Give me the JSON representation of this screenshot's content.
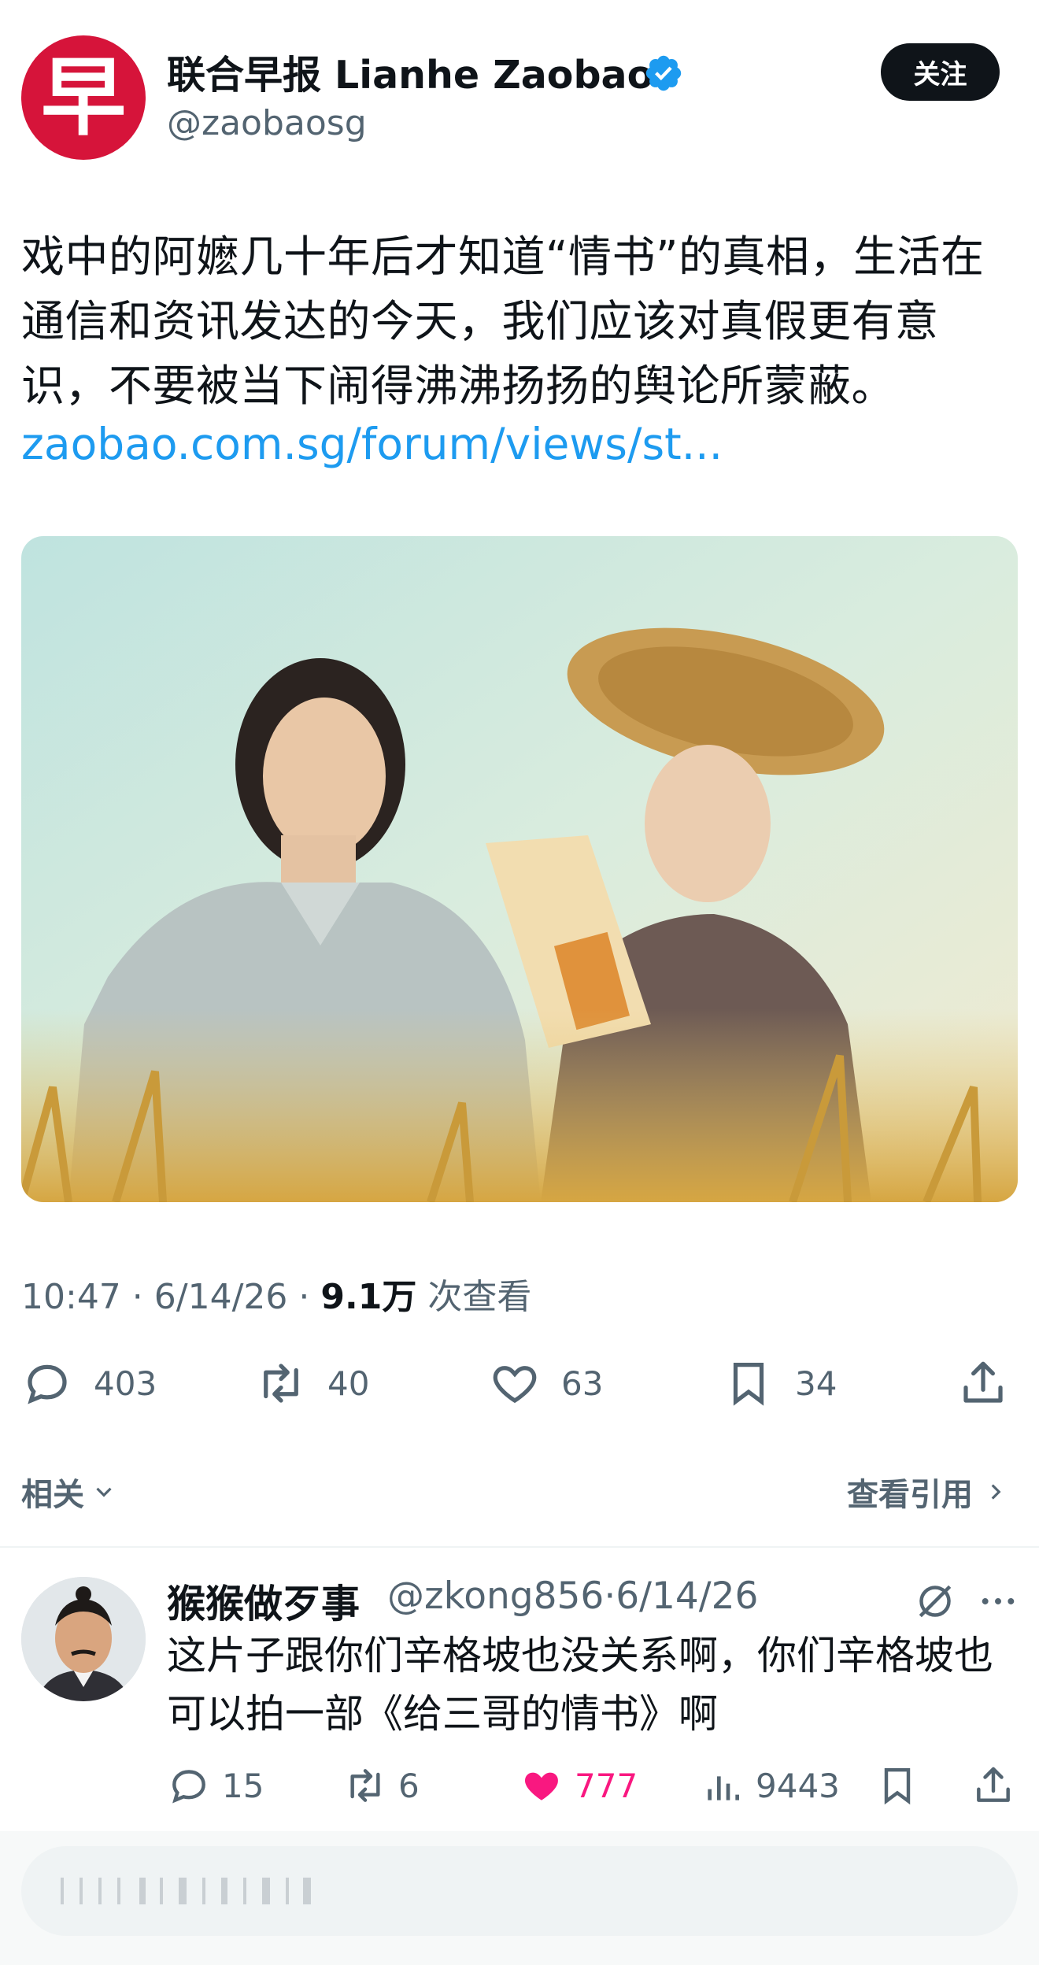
{
  "tweet": {
    "author_name": "联合早报 Lianhe Zaobao",
    "handle": "@zaobaosg",
    "avatar_char": "早",
    "follow_label": "关注",
    "text": "戏中的阿嬷几十年后才知道“情书”的真相，生活在通信和资讯发达的今天，我们应该对真假更有意识，不要被当下闹得沸沸扬扬的舆论所蒙蔽。",
    "link": "zaobao.com.sg/forum/views/st...",
    "time": "10:47",
    "date": "6/14/26",
    "views_count": "9.1万",
    "views_label": "次查看",
    "replies": "403",
    "retweets": "40",
    "likes": "63",
    "bookmarks": "34"
  },
  "related_label": "相关",
  "quotes_label": "查看引用",
  "reply": {
    "author_name": "猴猴做歹事",
    "handle": "@zkong856",
    "date": "6/14/26",
    "text": "这片子跟你们辛格坡也没关系啊，你们辛格坡也可以拍一部《给三哥的情书》啊",
    "replies": "15",
    "retweets": "6",
    "likes": "777",
    "views": "9443"
  },
  "colors": {
    "brand_red": "#d6143a",
    "link_blue": "#1d9bf0",
    "like_pink": "#f91880",
    "muted": "#536471"
  },
  "icons": [
    "verified-badge-icon",
    "reply-icon",
    "retweet-icon",
    "like-icon",
    "bookmark-icon",
    "share-icon",
    "chevron-down-icon",
    "chevron-right-icon",
    "grok-icon",
    "more-icon",
    "views-icon"
  ]
}
